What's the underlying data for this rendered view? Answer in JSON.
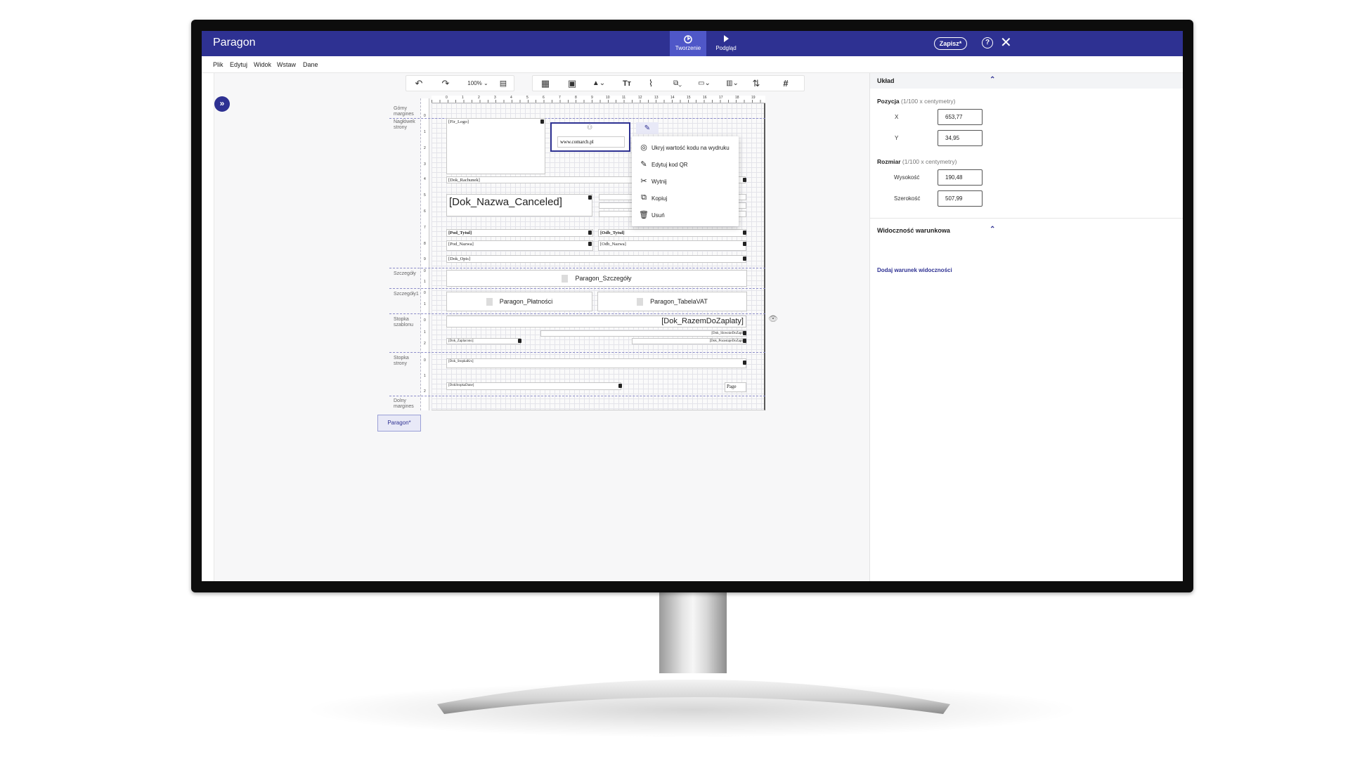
{
  "app": {
    "title": "Paragon",
    "save_label": "Zapisz*",
    "help": "?",
    "close": "✕"
  },
  "modes": [
    {
      "label": "Tworzenie",
      "icon": "design-icon"
    },
    {
      "label": "Podgląd",
      "icon": "play-icon"
    }
  ],
  "menu": [
    "Plik",
    "Edytuj",
    "Widok",
    "Wstaw",
    "Dane"
  ],
  "toolbar": {
    "zoom": "100%"
  },
  "band_labels": [
    "Górny margines",
    "Nagłówek strony",
    "Szczegóły",
    "Szczegóły1",
    "Stopka szablonu",
    "Stopka strony",
    "Dolny margines"
  ],
  "ruler": {
    "h": [
      "0",
      "1",
      "2",
      "3",
      "4",
      "5",
      "6",
      "7",
      "8",
      "9",
      "10",
      "11",
      "12",
      "13",
      "14",
      "15",
      "16",
      "17",
      "18",
      "19"
    ],
    "v_header": [
      "0",
      "1",
      "2",
      "3",
      "4",
      "5",
      "6",
      "7",
      "8",
      "9"
    ],
    "v_small": [
      "0",
      "1",
      "0",
      "1",
      "0",
      "1",
      "2",
      "0",
      "1",
      "2"
    ]
  },
  "fields": {
    "firm_logo": "[Fir_Logo]",
    "qr_value": "www.comarch.pl",
    "dok_rachunek": "[Dok_Rachunek]",
    "dok_nazwa": "[Dok_Nazwa_Canceled]",
    "pod_tytul": "[Pod_Tytul]",
    "odb_tytul": "[Odb_Tytul]",
    "pod_nazwa": "[Pod_Nazwa]",
    "odb_nazwa": "[Odb_Nazwa]",
    "dok_opis": "[Dok_Opis]",
    "sub_szczegoly": "Paragon_Szczegóły",
    "sub_platnosci": "Paragon_Płatności",
    "sub_tabela_vat": "Paragon_TabelaVAT",
    "razem": "[Dok_RazemDoZaplaty]",
    "slownie": "[Dok_SlownieDoZapla",
    "zaplacono": "[Dok_Zaplacono]",
    "pozostaje": "[Dok_PozostajeDoZapla",
    "stopka_krs": "[Dok_StopkaKrs]",
    "stopka_dane": "[DokStopkaDane]",
    "page": "Page"
  },
  "context_menu": [
    {
      "label": "Ukryj wartość kodu na wydruku",
      "icon": "eye-off-icon"
    },
    {
      "label": "Edytuj kod QR",
      "icon": "pencil-icon"
    },
    {
      "label": "Wytnij",
      "icon": "scissors-icon"
    },
    {
      "label": "Kopiuj",
      "icon": "copy-icon"
    },
    {
      "label": "Usuń",
      "icon": "trash-icon"
    }
  ],
  "report_tab": "Paragon*",
  "panel": {
    "layout_title": "Układ",
    "position_label": "Pozycja",
    "position_hint": "(1/100 x centymetry)",
    "x_label": "X",
    "x_value": "653,77",
    "y_label": "Y",
    "y_value": "34,95",
    "size_label": "Rozmiar",
    "size_hint": "(1/100 x centymetry)",
    "height_label": "Wysokość",
    "height_value": "190,48",
    "width_label": "Szerokość",
    "width_value": "507,99",
    "visibility_title": "Widoczność warunkowa",
    "add_visibility": "Dodaj warunek widoczności"
  },
  "colors": {
    "brand": "#2e3192",
    "brand_light": "#4f57c8",
    "selection_bg": "#e8e9f7"
  }
}
